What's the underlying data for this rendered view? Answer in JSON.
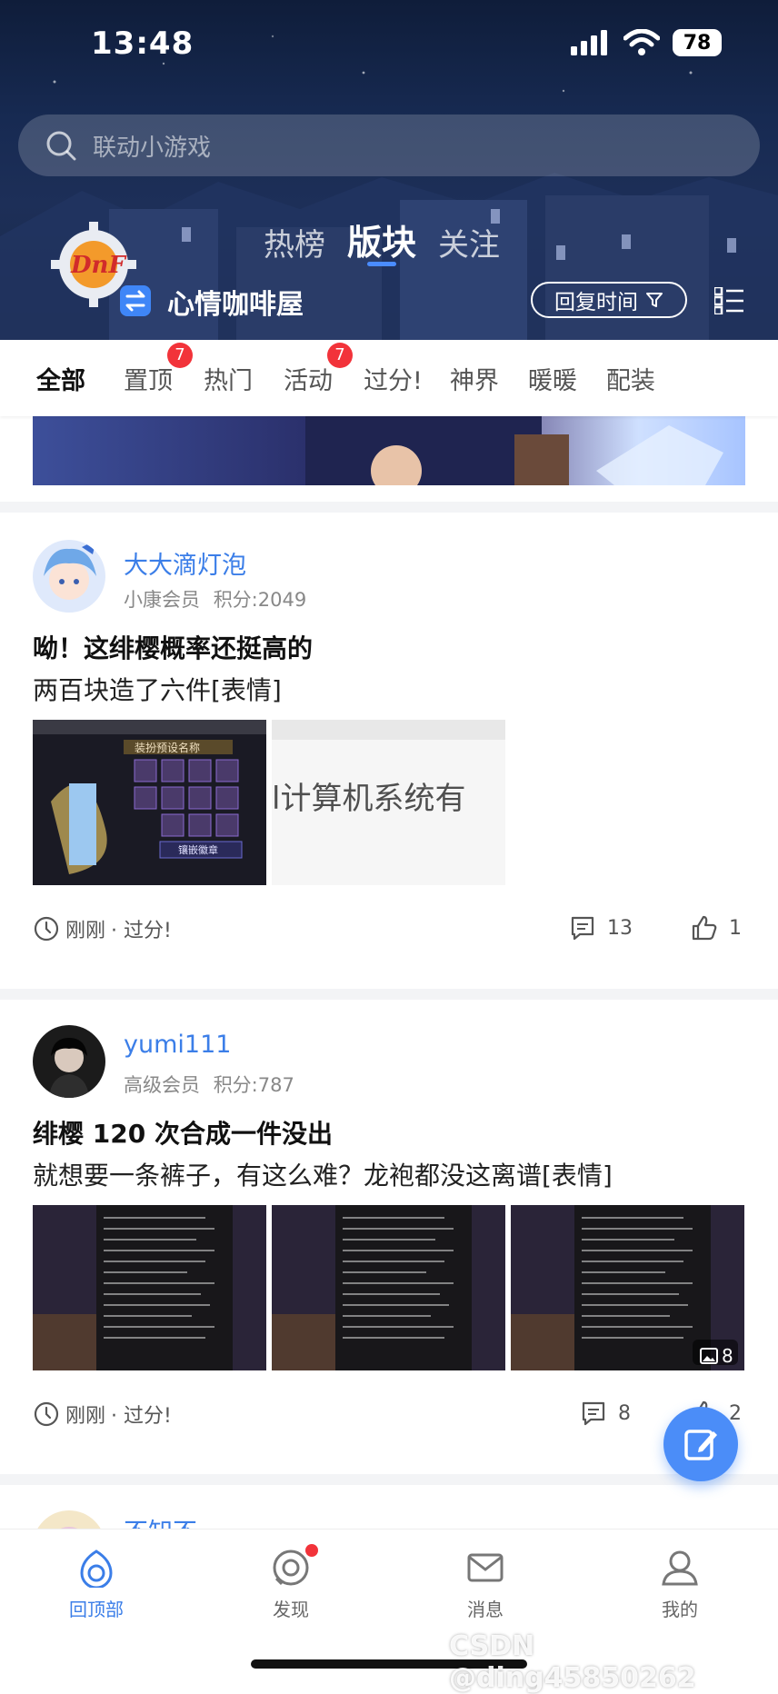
{
  "status_bar": {
    "time": "13:48",
    "battery": "78"
  },
  "search": {
    "placeholder": "联动小游戏"
  },
  "header": {
    "tabs": [
      {
        "label": "热榜"
      },
      {
        "label": "版块"
      },
      {
        "label": "关注"
      }
    ],
    "active_tab": "版块",
    "forum_name": "心情咖啡屋",
    "sort_label": "回复时间"
  },
  "categories": [
    {
      "label": "全部"
    },
    {
      "label": "置顶",
      "badge": "7"
    },
    {
      "label": "热门"
    },
    {
      "label": "活动",
      "badge": "7"
    },
    {
      "label": "过分!"
    },
    {
      "label": "神界"
    },
    {
      "label": "暖暖"
    },
    {
      "label": "配装"
    }
  ],
  "posts": [
    {
      "username": "大大滴灯泡",
      "member_level": "小康会员",
      "points": "积分:2049",
      "title": "呦！这绯樱概率还挺高的",
      "body": "两百块造了六件[表情]",
      "image_texts": [
        "装扮预设名称",
        "镶嵌徽章",
        "l计算机系统有"
      ],
      "time": "刚刚",
      "board": "· 过分!",
      "comments": "13",
      "likes": "1"
    },
    {
      "username": "yumi111",
      "member_level": "高级会员",
      "points": "积分:787",
      "title": "绯樱 120 次合成一件没出",
      "body": "就想要一条裤子，有这么难？龙袍都没这离谱[表情]",
      "image_count": "8",
      "time": "刚刚",
      "board": "· 过分!",
      "comments": "8",
      "likes": "2"
    },
    {
      "username": "不知不"
    }
  ],
  "bottom_nav": [
    {
      "label": "回顶部"
    },
    {
      "label": "发现"
    },
    {
      "label": "消息"
    },
    {
      "label": "我的"
    }
  ],
  "watermark": "CSDN @ding45850262",
  "colors": {
    "accent": "#3b7ee8",
    "badge": "#f2333a",
    "fab": "#4b8df8",
    "header_bg": "#172a52"
  }
}
